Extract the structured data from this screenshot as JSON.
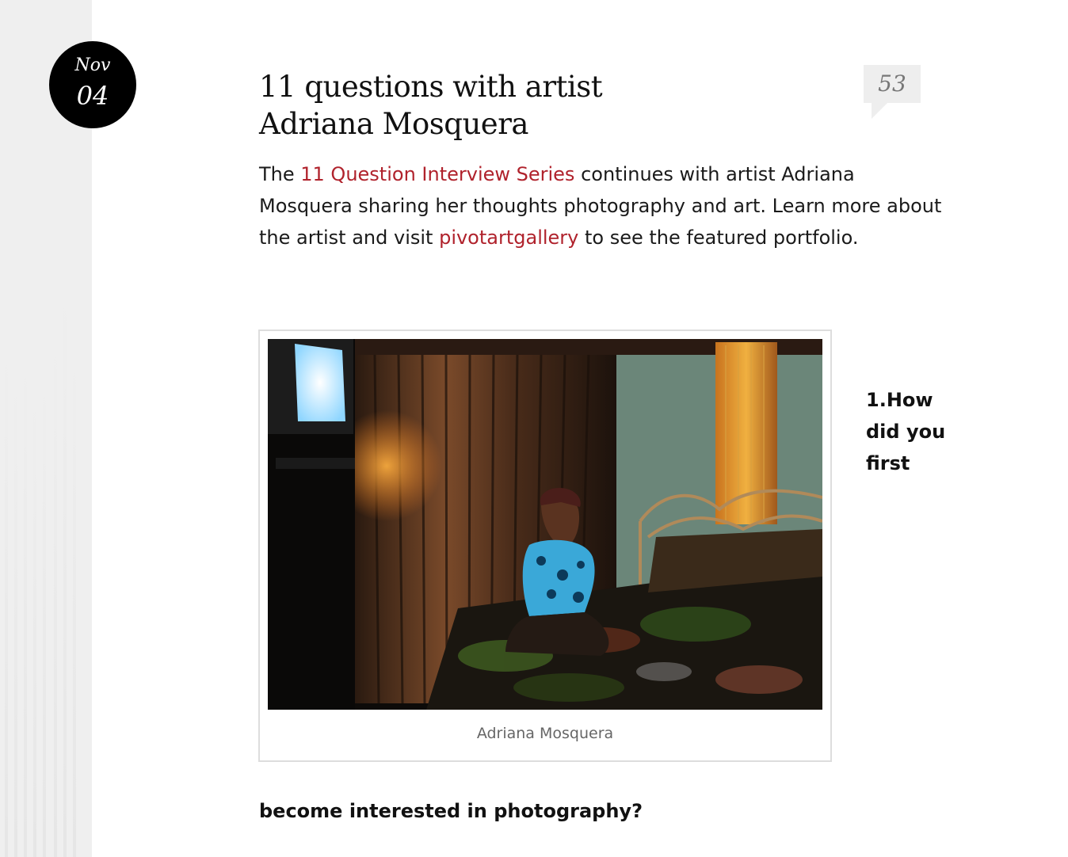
{
  "date": {
    "month": "Nov",
    "day": "04"
  },
  "post": {
    "title_line1": "11 questions with artist",
    "title_line2": "Adriana Mosquera",
    "comment_count": "53"
  },
  "intro": {
    "text_1": "The ",
    "link_1": "11 Question Interview Series",
    "text_2": " continues with artist Adriana Mosquera sharing her thoughts photography and art. Learn more about the artist and visit ",
    "link_2": "pivotartgallery",
    "text_3": " to see the featured portfolio."
  },
  "figure": {
    "caption": "Adriana Mosquera"
  },
  "question_1": {
    "side_lines": [
      "1.How",
      "did you",
      "first"
    ],
    "continuation": "become interested in photography?"
  },
  "colors": {
    "link": "#b0222c",
    "badge": "#000000",
    "bubble": "#eeeeee"
  },
  "icons": {
    "comments": "speech-bubble"
  }
}
